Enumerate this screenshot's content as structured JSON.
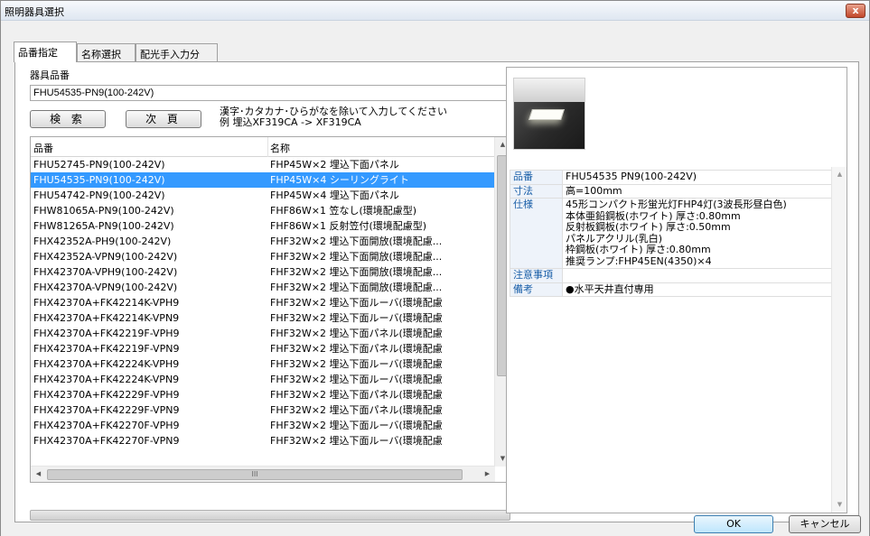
{
  "window": {
    "title": "照明器具選択",
    "close_glyph": "x"
  },
  "tabs": [
    {
      "label": "品番指定",
      "active": true
    },
    {
      "label": "名称選択",
      "active": false
    },
    {
      "label": "配光手入力分",
      "active": false
    }
  ],
  "search": {
    "label": "器具品番",
    "value": "FHU54535-PN9(100-242V)",
    "search_button": "検 索",
    "next_button": "次 頁",
    "hint_line1": "漢字･カタカナ･ひらがなを除いて入力してください",
    "hint_line2": "例 埋込XF319CA -> XF319CA"
  },
  "list": {
    "columns": [
      "品番",
      "名称"
    ],
    "selected_index": 1,
    "rows": [
      [
        "FHU52745-PN9(100-242V)",
        "FHP45W×2 埋込下面パネル"
      ],
      [
        "FHU54535-PN9(100-242V)",
        "FHP45W×4 シーリングライト"
      ],
      [
        "FHU54742-PN9(100-242V)",
        "FHP45W×4 埋込下面パネル"
      ],
      [
        "FHW81065A-PN9(100-242V)",
        "FHF86W×1 笠なし(環境配慮型)"
      ],
      [
        "FHW81265A-PN9(100-242V)",
        "FHF86W×1 反射笠付(環境配慮型)"
      ],
      [
        "FHX42352A-PH9(100-242V)",
        "FHF32W×2 埋込下面開放(環境配慮..."
      ],
      [
        "FHX42352A-VPN9(100-242V)",
        "FHF32W×2 埋込下面開放(環境配慮..."
      ],
      [
        "FHX42370A-VPH9(100-242V)",
        "FHF32W×2 埋込下面開放(環境配慮..."
      ],
      [
        "FHX42370A-VPN9(100-242V)",
        "FHF32W×2 埋込下面開放(環境配慮..."
      ],
      [
        "FHX42370A+FK42214K-VPH9",
        "FHF32W×2 埋込下面ルーバ(環境配慮"
      ],
      [
        "FHX42370A+FK42214K-VPN9",
        "FHF32W×2 埋込下面ルーバ(環境配慮"
      ],
      [
        "FHX42370A+FK42219F-VPH9",
        "FHF32W×2 埋込下面パネル(環境配慮"
      ],
      [
        "FHX42370A+FK42219F-VPN9",
        "FHF32W×2 埋込下面パネル(環境配慮"
      ],
      [
        "FHX42370A+FK42224K-VPH9",
        "FHF32W×2 埋込下面ルーバ(環境配慮"
      ],
      [
        "FHX42370A+FK42224K-VPN9",
        "FHF32W×2 埋込下面ルーバ(環境配慮"
      ],
      [
        "FHX42370A+FK42229F-VPH9",
        "FHF32W×2 埋込下面パネル(環境配慮"
      ],
      [
        "FHX42370A+FK42229F-VPN9",
        "FHF32W×2 埋込下面パネル(環境配慮"
      ],
      [
        "FHX42370A+FK42270F-VPH9",
        "FHF32W×2 埋込下面ルーバ(環境配慮"
      ],
      [
        "FHX42370A+FK42270F-VPN9",
        "FHF32W×2 埋込下面ルーバ(環境配慮"
      ]
    ],
    "hscroll_grip": "III"
  },
  "detail": {
    "image_icon": "ceiling-light-photo",
    "specs": [
      {
        "key": "品番",
        "lines": [
          "FHU54535 PN9(100-242V)"
        ]
      },
      {
        "key": "寸法",
        "lines": [
          "高=100mm"
        ]
      },
      {
        "key": "仕様",
        "lines": [
          "45形コンパクト形蛍光灯FHP4灯(3波長形昼白色)",
          "本体亜鉛鋼板(ホワイト) 厚さ:0.80mm",
          "反射板鋼板(ホワイト) 厚さ:0.50mm",
          "パネルアクリル(乳白)",
          "枠鋼板(ホワイト) 厚さ:0.80mm",
          "推奨ランプ:FHP45EN(4350)×4"
        ]
      },
      {
        "key": "注意事項",
        "lines": [
          ""
        ]
      },
      {
        "key": "備考",
        "lines": [
          "●水平天井直付専用"
        ]
      }
    ]
  },
  "footer": {
    "ok": "OK",
    "cancel": "キャンセル"
  },
  "colors": {
    "selection": "#3399ff",
    "spec_key": "#1a5fa8"
  }
}
